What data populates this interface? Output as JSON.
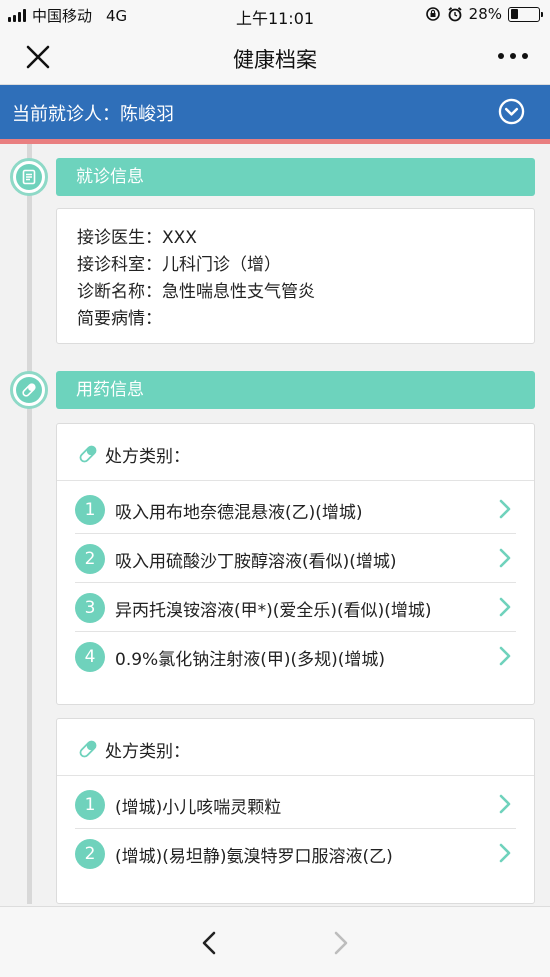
{
  "status_bar": {
    "carrier": "中国移动",
    "network": "4G",
    "time": "上午11:01",
    "battery": "28%",
    "battery_level": 0.28
  },
  "nav": {
    "title": "健康档案",
    "close_icon": "close-icon",
    "more_icon": "more-icon"
  },
  "patient": {
    "label": "当前就诊人：陈峻羽",
    "toggle_icon": "chevron-down-circle-icon"
  },
  "visit_info": {
    "title": "就诊信息",
    "icon": "document-icon",
    "lines": [
      "接诊医生：XXX",
      "接诊科室：儿科门诊（增）",
      "诊断名称：急性喘息性支气管炎",
      "简要病情："
    ]
  },
  "medication": {
    "title": "用药信息",
    "icon": "pill-icon",
    "prescriptions": [
      {
        "category_label": "处方类别：",
        "items": [
          {
            "num": "1",
            "name": "吸入用布地奈德混悬液(乙)(增城)"
          },
          {
            "num": "2",
            "name": "吸入用硫酸沙丁胺醇溶液(看似)(增城)"
          },
          {
            "num": "3",
            "name": "异丙托溴铵溶液(甲*)(爱全乐)(看似)(增城)"
          },
          {
            "num": "4",
            "name": "0.9%氯化钠注射液(甲)(多规)(增城)"
          }
        ]
      },
      {
        "category_label": "处方类别：",
        "items": [
          {
            "num": "1",
            "name": "(增城)小儿咳喘灵颗粒"
          },
          {
            "num": "2",
            "name": "(增城)(易坦静)氨溴特罗口服溶液(乙)"
          }
        ]
      }
    ]
  },
  "colors": {
    "accent": "#6dd3bd",
    "patient_bar": "#2f6fb9",
    "strip": "#e97f80"
  }
}
